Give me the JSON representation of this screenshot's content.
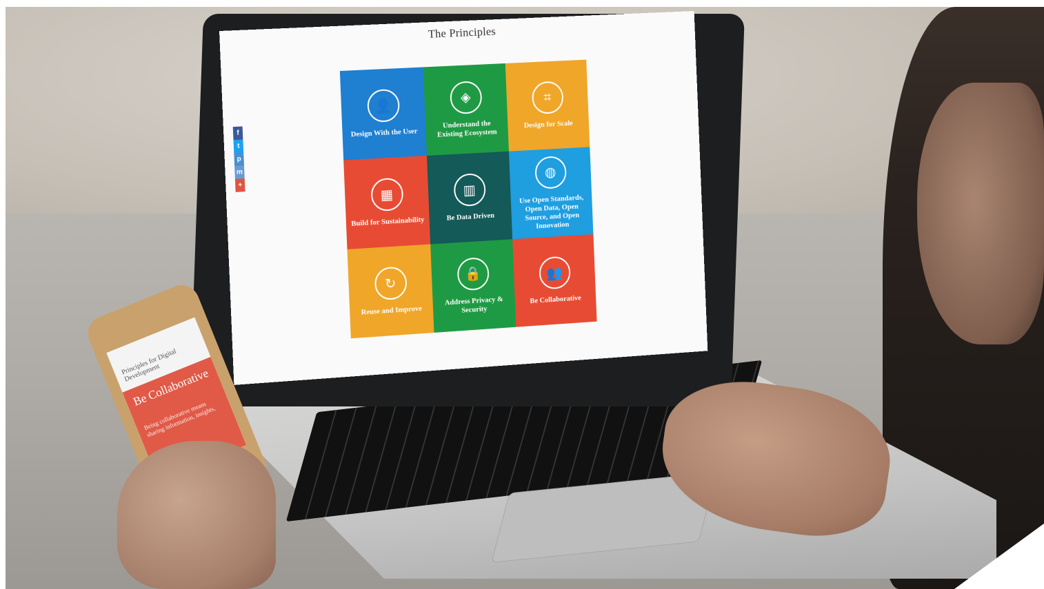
{
  "site": {
    "title": "The Principles"
  },
  "share_buttons": [
    {
      "icon": "f",
      "color": "#3b5998"
    },
    {
      "icon": "t",
      "color": "#1da1f2"
    },
    {
      "icon": "p",
      "color": "#4a8fd0"
    },
    {
      "icon": "m",
      "color": "#6b9ad3"
    },
    {
      "icon": "+",
      "color": "#e2533f"
    }
  ],
  "principles": [
    {
      "label": "Design With the User",
      "color": "#1f7fd1",
      "icon": "user-icon",
      "glyph": "👤"
    },
    {
      "label": "Understand the Existing Ecosystem",
      "color": "#1f9a44",
      "icon": "ecosystem-icon",
      "glyph": "◈"
    },
    {
      "label": "Design for Scale",
      "color": "#f0a629",
      "icon": "crop-icon",
      "glyph": "⌗"
    },
    {
      "label": "Build for Sustainability",
      "color": "#e84b33",
      "icon": "bricks-icon",
      "glyph": "▦"
    },
    {
      "label": "Be Data Driven",
      "color": "#135a58",
      "icon": "chart-icon",
      "glyph": "▥"
    },
    {
      "label": "Use Open Standards, Open Data, Open Source, and Open Innovation",
      "color": "#1f9ee0",
      "icon": "globe-icon",
      "glyph": "◍"
    },
    {
      "label": "Reuse and Improve",
      "color": "#f0a629",
      "icon": "cycle-icon",
      "glyph": "↻"
    },
    {
      "label": "Address Privacy & Security",
      "color": "#1f9a44",
      "icon": "lock-icon",
      "glyph": "🔒"
    },
    {
      "label": "Be Collaborative",
      "color": "#e84b33",
      "icon": "people-icon",
      "glyph": "👥"
    }
  ],
  "phone": {
    "logo": "Principles for Digital Development",
    "hero_title": "Be Collaborative",
    "hero_text": "Being collaborative means sharing information, insights,"
  }
}
